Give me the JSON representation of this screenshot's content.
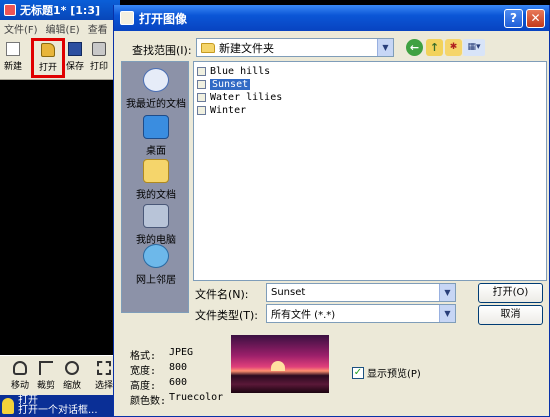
{
  "app": {
    "title": "无标题1* [1:3]",
    "menu": [
      "文件(F)",
      "编辑(E)",
      "查看"
    ],
    "toolbar": {
      "new": "新建",
      "open": "打开",
      "save": "保存",
      "print": "打印"
    },
    "bottom_tools": {
      "move": "移动",
      "crop": "裁剪",
      "zoom": "缩放",
      "select": "选择"
    },
    "status": {
      "title": "打开",
      "desc": "打开一个对话框..."
    }
  },
  "dialog": {
    "title": "打开图像",
    "help_label": "?",
    "close_label": "✕",
    "lookin_label": "查找范围(I):",
    "lookin_value": "新建文件夹",
    "places": [
      "我最近的文档",
      "桌面",
      "我的文档",
      "我的电脑",
      "网上邻居"
    ],
    "files": [
      "Blue hills",
      "Sunset",
      "Water lilies",
      "Winter"
    ],
    "selected_file": "Sunset",
    "filename_label": "文件名(N):",
    "filename_value": "Sunset",
    "filetype_label": "文件类型(T):",
    "filetype_value": "所有文件 (*.*)",
    "open_button": "打开(O)",
    "cancel_button": "取消",
    "info": {
      "format_label": "格式:",
      "format_value": "JPEG",
      "width_label": "宽度:",
      "width_value": "800",
      "height_label": "高度:",
      "height_value": "600",
      "colors_label": "颜色数:",
      "colors_value": "Truecolor"
    },
    "show_preview_label": "显示预览(P)",
    "show_preview_checked": true
  }
}
